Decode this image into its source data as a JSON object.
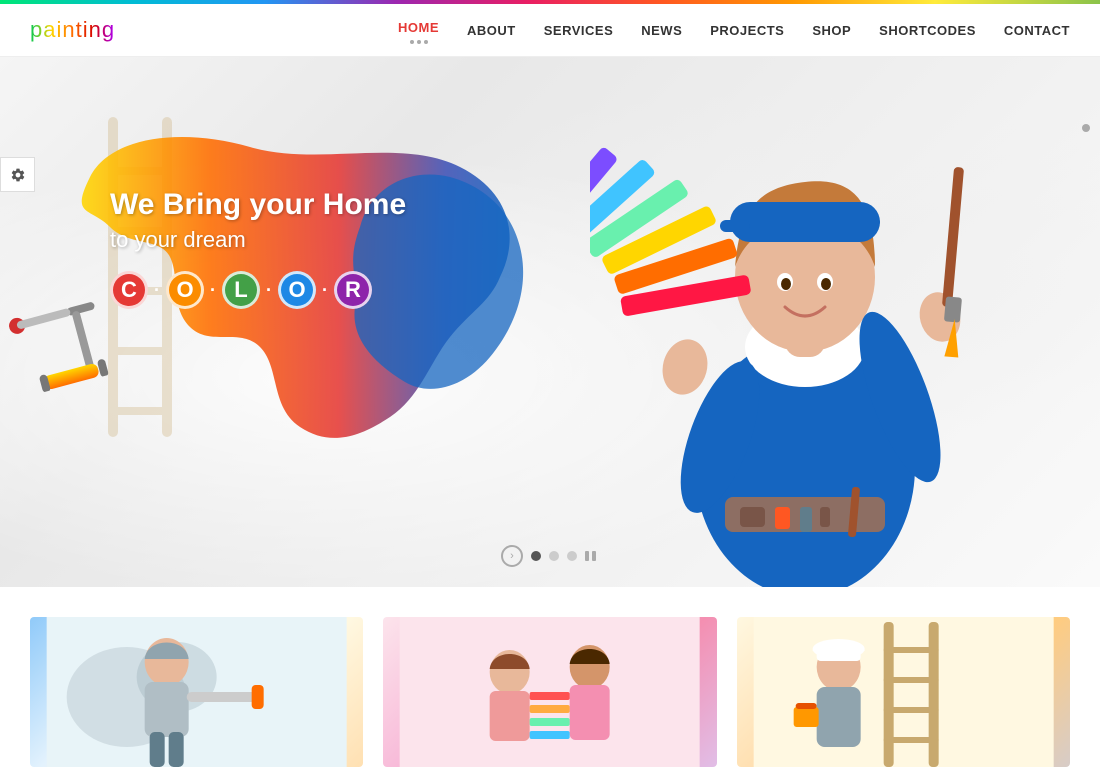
{
  "site": {
    "logo": "painting",
    "tagline": "We Bring your Home",
    "tagline2": "to your dream",
    "color_word": "C·O·L·O·R"
  },
  "nav": {
    "items": [
      {
        "label": "HOME",
        "active": true,
        "has_dots": true
      },
      {
        "label": "ABOUT",
        "active": false
      },
      {
        "label": "SERVICES",
        "active": false
      },
      {
        "label": "NEWS",
        "active": false
      },
      {
        "label": "PROJECTS",
        "active": false
      },
      {
        "label": "SHOP",
        "active": false
      },
      {
        "label": "SHORTCODES",
        "active": false
      },
      {
        "label": "CONTACT",
        "active": false
      }
    ]
  },
  "hero": {
    "headline": "We Bring your Home",
    "subheadline": "to your dream",
    "color_letters": [
      {
        "char": "C",
        "color": "#e53935"
      },
      {
        "char": "O",
        "color": "#fb8c00"
      },
      {
        "char": "L",
        "color": "#43a047"
      },
      {
        "char": "O",
        "color": "#1e88e5"
      },
      {
        "char": "R",
        "color": "#8e24aa"
      }
    ],
    "slider_dots": 3
  },
  "cards": [
    {
      "id": 1,
      "alt": "painter person"
    },
    {
      "id": 2,
      "alt": "painting consultation"
    },
    {
      "id": 3,
      "alt": "painting tools"
    }
  ],
  "icons": {
    "gear": "⚙",
    "chevron_right": "›"
  }
}
